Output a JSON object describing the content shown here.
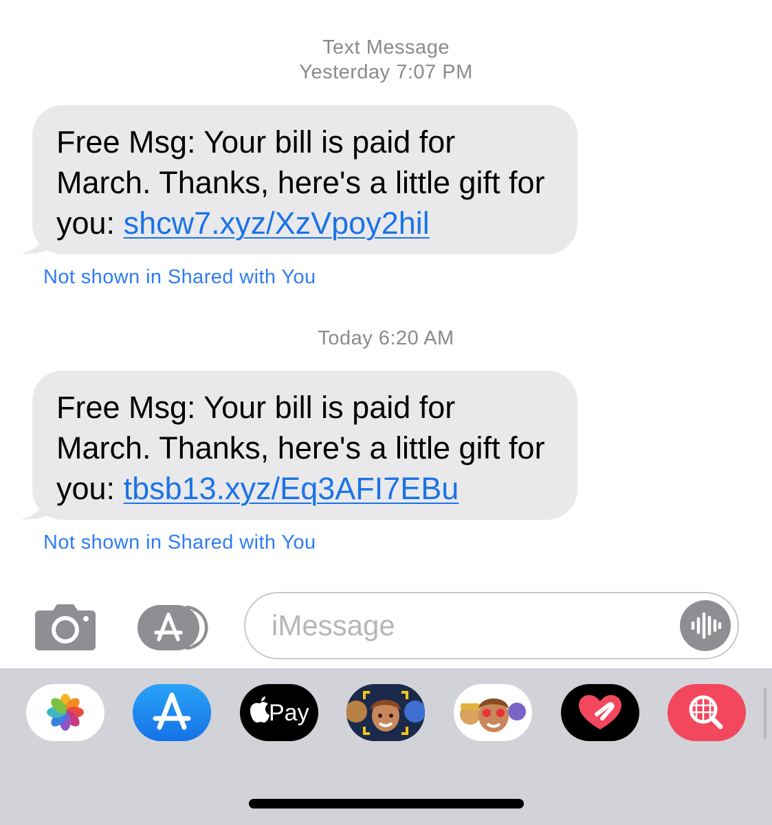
{
  "conversation": {
    "header_type": "Text Message",
    "header_time": "Yesterday 7:07 PM",
    "messages": [
      {
        "text": "Free Msg: Your bill is paid for March. Thanks, here's a little gift for you: ",
        "link": "shcw7.xyz/XzVpoy2hil",
        "note": "Not shown in Shared with You"
      },
      {
        "timestamp": "Today 6:20 AM",
        "text": "Free Msg: Your bill is paid for March. Thanks, here's a little gift for you: ",
        "link": "tbsb13.xyz/Eq3AFI7EBu",
        "note": "Not shown in Shared with You"
      }
    ]
  },
  "input_bar": {
    "placeholder": "iMessage",
    "icons": [
      "camera-icon",
      "app-store-icon",
      "voice-waveform-icon"
    ]
  },
  "app_drawer": {
    "apps": [
      {
        "name": "photos-icon"
      },
      {
        "name": "app-store-icon"
      },
      {
        "name": "apple-pay-icon",
        "label": "Pay"
      },
      {
        "name": "memoji-icon"
      },
      {
        "name": "memoji-stickers-icon"
      },
      {
        "name": "digital-touch-icon"
      },
      {
        "name": "image-search-icon"
      }
    ]
  },
  "colors": {
    "bubble": "#e9e9eb",
    "link": "#1a73e8",
    "note": "#2f7cf6",
    "meta": "#8a8a8e",
    "drawer": "#d2d3d8"
  }
}
